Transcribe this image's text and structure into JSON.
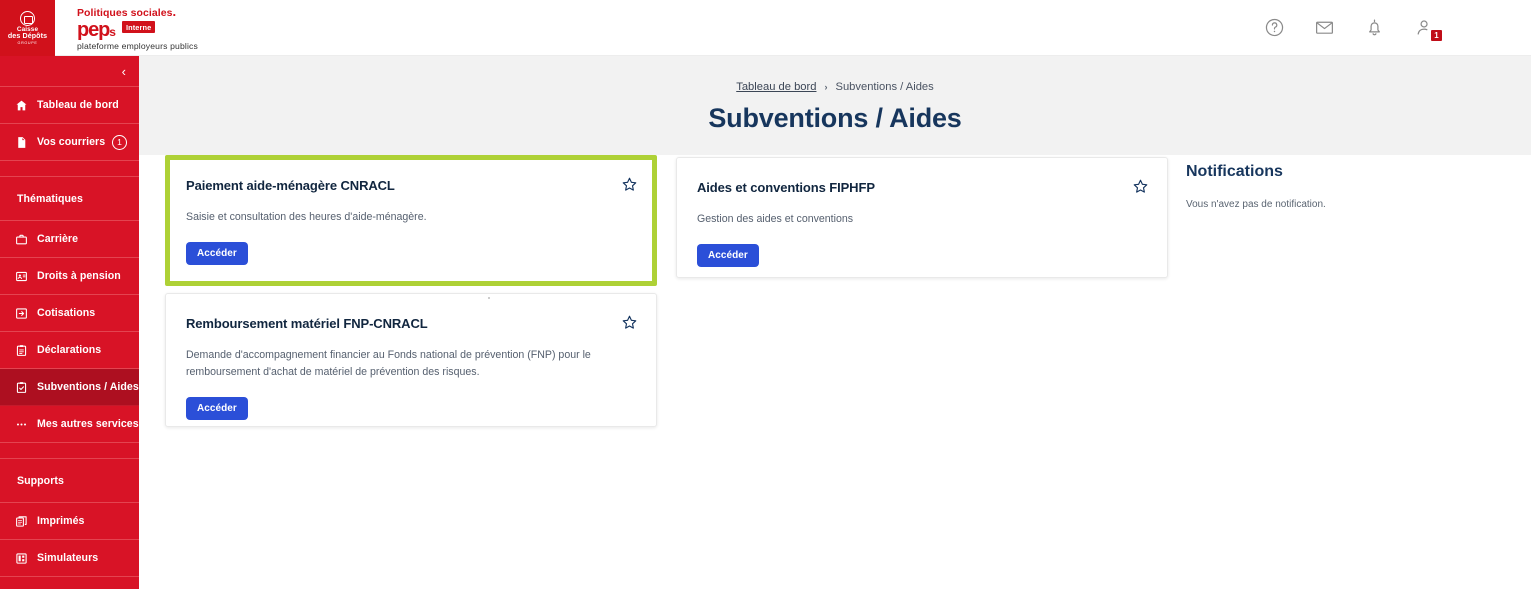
{
  "brand": {
    "institution_line1": "Caisse",
    "institution_line2": "des Dépôts",
    "institution_line3": "GROUPE",
    "tagline": "Politiques sociales",
    "tagline_dot": ".",
    "product": "pep",
    "product_suffix": "s",
    "badge": "Interne",
    "subtitle": "plateforme employeurs publics"
  },
  "topbar": {
    "icons": [
      {
        "name": "help-icon",
        "label": "Aide"
      },
      {
        "name": "mail-icon",
        "label": "Messagerie"
      },
      {
        "name": "bell-icon",
        "label": "Notifications"
      },
      {
        "name": "user-account-icon",
        "label": "Mon compte"
      }
    ],
    "user_badge_count": "1",
    "faint_text_1": "",
    "faint_text_2": "",
    "faint_text_3": ""
  },
  "sidebar": {
    "collapse_label": "‹",
    "items": [
      {
        "label": "Tableau de bord",
        "icon": "home-icon",
        "active": false,
        "count": null
      },
      {
        "label": "Vos courriers",
        "icon": "document-icon",
        "active": false,
        "count": "1"
      }
    ],
    "section_thematiques": "Thématiques",
    "thematiques": [
      {
        "label": "Carrière",
        "icon": "briefcase-icon",
        "active": false
      },
      {
        "label": "Droits à pension",
        "icon": "id-card-icon",
        "active": false
      },
      {
        "label": "Cotisations",
        "icon": "arrow-into-box-icon",
        "active": false
      },
      {
        "label": "Déclarations",
        "icon": "clipboard-icon",
        "active": false
      },
      {
        "label": "Subventions / Aides",
        "icon": "clipboard-check-icon",
        "active": true
      },
      {
        "label": "Mes autres services",
        "icon": "ellipsis-icon",
        "active": false
      }
    ],
    "section_supports": "Supports",
    "supports": [
      {
        "label": "Imprimés",
        "icon": "printed-forms-icon"
      },
      {
        "label": "Simulateurs",
        "icon": "calculator-icon"
      }
    ]
  },
  "page": {
    "breadcrumb_home": "Tableau de bord",
    "breadcrumb_sep": "›",
    "breadcrumb_current": "Subventions / Aides",
    "title": "Subventions / Aides"
  },
  "cards": [
    {
      "title": "Paiement aide-ménagère CNRACL",
      "description": "Saisie et consultation des heures d'aide-ménagère.",
      "button": "Accéder",
      "star_icon": "star-outline-icon",
      "highlighted": true
    },
    {
      "title": "Aides et conventions FIPHFP",
      "description": "Gestion des aides et conventions",
      "button": "Accéder",
      "star_icon": "star-outline-icon",
      "highlighted": false
    },
    {
      "title": "Remboursement matériel FNP-CNRACL",
      "description": "Demande d'accompagnement financier au Fonds national de prévention (FNP) pour le remboursement d'achat de matériel de prévention des risques.",
      "button": "Accéder",
      "star_icon": "star-outline-icon",
      "highlighted": false
    }
  ],
  "notifications": {
    "title": "Notifications",
    "empty_message": "Vous n'avez pas de notification."
  },
  "colors": {
    "brand_red": "#d1111b",
    "sidebar_red": "#d81326",
    "sidebar_active": "#ad0f20",
    "highlight_green": "#aed136",
    "button_blue": "#2b4fd8",
    "title_navy": "#17365d",
    "page_head_gray": "#f2f2f2"
  }
}
